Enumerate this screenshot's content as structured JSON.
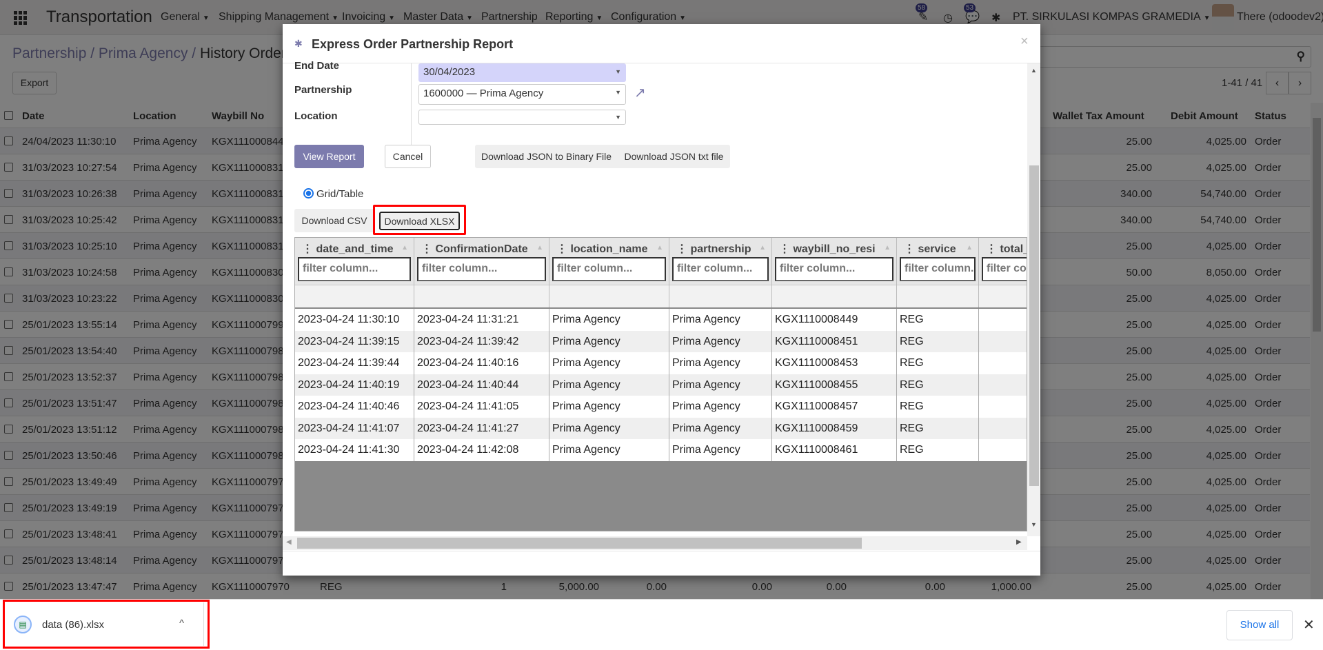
{
  "navbar": {
    "app_title": "Transportation",
    "menus": [
      {
        "label": "General",
        "dropdown": true
      },
      {
        "label": "Shipping Management",
        "dropdown": true
      },
      {
        "label": "Invoicing",
        "dropdown": true
      },
      {
        "label": "Master Data",
        "dropdown": true
      },
      {
        "label": "Partnership",
        "dropdown": false
      },
      {
        "label": "Reporting",
        "dropdown": true
      },
      {
        "label": "Configuration",
        "dropdown": true
      }
    ],
    "activity_badge": "58",
    "messages_badge": "53",
    "company": "PT. SIRKULASI KOMPAS GRAMEDIA",
    "user": "There (odoodev2)"
  },
  "breadcrumb": {
    "items": [
      "Partnership",
      "Prima Agency"
    ],
    "current": "History Order"
  },
  "controls": {
    "export_label": "Export",
    "pager": "1-41 / 41"
  },
  "list": {
    "headers": {
      "date": "Date",
      "location": "Location",
      "waybill": "Waybill No",
      "wallet_tax": "Wallet Tax Amount",
      "debit": "Debit Amount",
      "status": "Status"
    },
    "rows": [
      {
        "date": "24/04/2023 11:30:10",
        "location": "Prima Agency",
        "waybill": "KGX111000844",
        "wallet_tax": "25.00",
        "debit": "4,025.00",
        "status": "Order"
      },
      {
        "date": "31/03/2023 10:27:54",
        "location": "Prima Agency",
        "waybill": "KGX111000831",
        "wallet_tax": "25.00",
        "debit": "4,025.00",
        "status": "Order"
      },
      {
        "date": "31/03/2023 10:26:38",
        "location": "Prima Agency",
        "waybill": "KGX111000831",
        "wallet_tax": "340.00",
        "debit": "54,740.00",
        "status": "Order"
      },
      {
        "date": "31/03/2023 10:25:42",
        "location": "Prima Agency",
        "waybill": "KGX111000831",
        "wallet_tax": "340.00",
        "debit": "54,740.00",
        "status": "Order"
      },
      {
        "date": "31/03/2023 10:25:10",
        "location": "Prima Agency",
        "waybill": "KGX111000831",
        "wallet_tax": "25.00",
        "debit": "4,025.00",
        "status": "Order"
      },
      {
        "date": "31/03/2023 10:24:58",
        "location": "Prima Agency",
        "waybill": "KGX111000830",
        "wallet_tax": "50.00",
        "debit": "8,050.00",
        "status": "Order"
      },
      {
        "date": "31/03/2023 10:23:22",
        "location": "Prima Agency",
        "waybill": "KGX111000830",
        "wallet_tax": "25.00",
        "debit": "4,025.00",
        "status": "Order"
      },
      {
        "date": "25/01/2023 13:55:14",
        "location": "Prima Agency",
        "waybill": "KGX111000799",
        "wallet_tax": "25.00",
        "debit": "4,025.00",
        "status": "Order"
      },
      {
        "date": "25/01/2023 13:54:40",
        "location": "Prima Agency",
        "waybill": "KGX111000798",
        "wallet_tax": "25.00",
        "debit": "4,025.00",
        "status": "Order"
      },
      {
        "date": "25/01/2023 13:52:37",
        "location": "Prima Agency",
        "waybill": "KGX111000798",
        "wallet_tax": "25.00",
        "debit": "4,025.00",
        "status": "Order"
      },
      {
        "date": "25/01/2023 13:51:47",
        "location": "Prima Agency",
        "waybill": "KGX111000798",
        "wallet_tax": "25.00",
        "debit": "4,025.00",
        "status": "Order"
      },
      {
        "date": "25/01/2023 13:51:12",
        "location": "Prima Agency",
        "waybill": "KGX111000798",
        "wallet_tax": "25.00",
        "debit": "4,025.00",
        "status": "Order"
      },
      {
        "date": "25/01/2023 13:50:46",
        "location": "Prima Agency",
        "waybill": "KGX111000798",
        "wallet_tax": "25.00",
        "debit": "4,025.00",
        "status": "Order"
      },
      {
        "date": "25/01/2023 13:49:49",
        "location": "Prima Agency",
        "waybill": "KGX111000797",
        "wallet_tax": "25.00",
        "debit": "4,025.00",
        "status": "Order"
      },
      {
        "date": "25/01/2023 13:49:19",
        "location": "Prima Agency",
        "waybill": "KGX111000797",
        "wallet_tax": "25.00",
        "debit": "4,025.00",
        "status": "Order"
      },
      {
        "date": "25/01/2023 13:48:41",
        "location": "Prima Agency",
        "waybill": "KGX111000797",
        "wallet_tax": "25.00",
        "debit": "4,025.00",
        "status": "Order"
      },
      {
        "date": "25/01/2023 13:48:14",
        "location": "Prima Agency",
        "waybill": "KGX111000797",
        "wallet_tax": "25.00",
        "debit": "4,025.00",
        "status": "Order"
      },
      {
        "date": "25/01/2023 13:47:47",
        "location": "Prima Agency",
        "waybill": "KGX1110007970",
        "service": "REG",
        "qty": "1",
        "v1": "5,000.00",
        "v2": "0.00",
        "v3": "0.00",
        "v4": "0.00",
        "v5": "0.00",
        "v6": "1,000.00",
        "wallet_tax": "25.00",
        "debit": "4,025.00",
        "status": "Order"
      }
    ]
  },
  "modal": {
    "title": "Express Order Partnership Report",
    "fields": {
      "end_date_label": "End Date",
      "end_date": "30/04/2023",
      "partnership_label": "Partnership",
      "partnership": "1600000 — Prima Agency",
      "location_label": "Location",
      "location": ""
    },
    "buttons": {
      "view_report": "View Report",
      "cancel": "Cancel",
      "json_binary": "Download JSON to Binary File",
      "json_txt": "Download JSON txt file"
    },
    "radio_label": "Grid/Table",
    "download_csv": "Download CSV",
    "download_xlsx": "Download XLSX",
    "filter_placeholder": "filter column...",
    "grid": {
      "columns": [
        "date_and_time",
        "ConfirmationDate",
        "location_name",
        "partnership",
        "waybill_no_resi",
        "service",
        "total_"
      ],
      "rows": [
        [
          "2023-04-24 11:30:10",
          "2023-04-24 11:31:21",
          "Prima Agency",
          "Prima Agency",
          "KGX1110008449",
          "REG",
          ""
        ],
        [
          "2023-04-24 11:39:15",
          "2023-04-24 11:39:42",
          "Prima Agency",
          "Prima Agency",
          "KGX1110008451",
          "REG",
          ""
        ],
        [
          "2023-04-24 11:39:44",
          "2023-04-24 11:40:16",
          "Prima Agency",
          "Prima Agency",
          "KGX1110008453",
          "REG",
          ""
        ],
        [
          "2023-04-24 11:40:19",
          "2023-04-24 11:40:44",
          "Prima Agency",
          "Prima Agency",
          "KGX1110008455",
          "REG",
          ""
        ],
        [
          "2023-04-24 11:40:46",
          "2023-04-24 11:41:05",
          "Prima Agency",
          "Prima Agency",
          "KGX1110008457",
          "REG",
          ""
        ],
        [
          "2023-04-24 11:41:07",
          "2023-04-24 11:41:27",
          "Prima Agency",
          "Prima Agency",
          "KGX1110008459",
          "REG",
          ""
        ],
        [
          "2023-04-24 11:41:30",
          "2023-04-24 11:42:08",
          "Prima Agency",
          "Prima Agency",
          "KGX1110008461",
          "REG",
          ""
        ]
      ]
    }
  },
  "download_bar": {
    "filename": "data (86).xlsx",
    "show_all": "Show all"
  },
  "colors": {
    "brand": "#7c7bad",
    "highlight": "#ff0000",
    "link": "#1a73e8",
    "date_field_bg": "#d4d4fa"
  }
}
